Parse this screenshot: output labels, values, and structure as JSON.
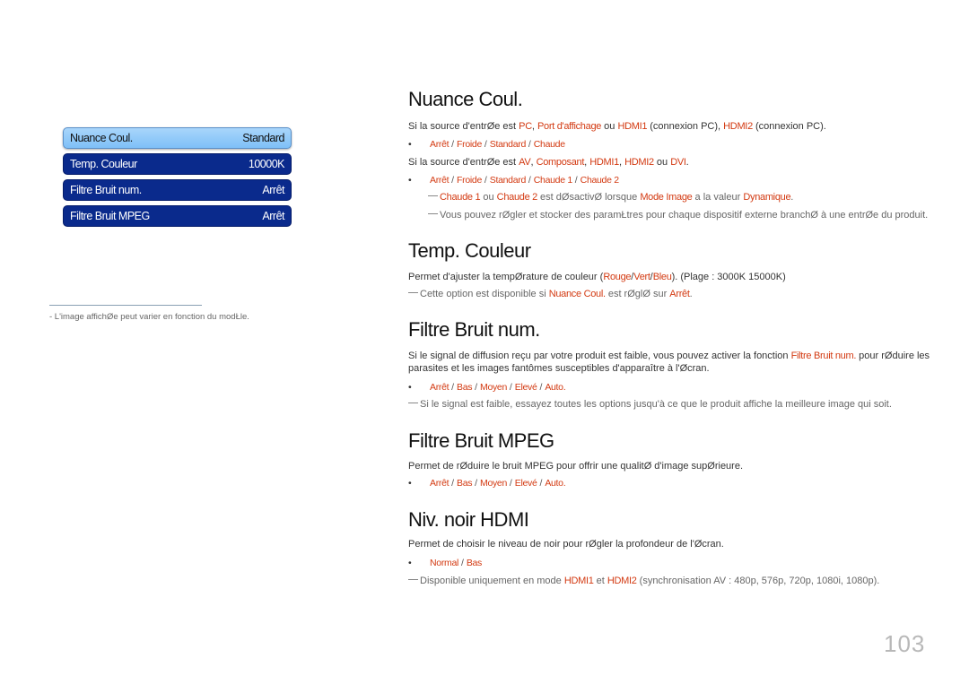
{
  "menu": {
    "rows": [
      {
        "label": "Nuance Coul.",
        "value": "Standard",
        "selected": true
      },
      {
        "label": "Temp. Couleur",
        "value": "10000K"
      },
      {
        "label": "Filtre Bruit num.",
        "value": "Arrêt"
      },
      {
        "label": "Filtre Bruit MPEG",
        "value": "Arrêt"
      }
    ]
  },
  "footnote": "-   L'image affichØe peut varier en fonction du modŁle.",
  "sections": {
    "nuance": {
      "title": "Nuance Coul.",
      "p1_pre": "Si la source d'entrØe est ",
      "p1_h1": "PC",
      "p1_sep1": ", ",
      "p1_h2": "Port d'affichage",
      "p1_mid": " ou ",
      "p1_h3": "HDMI1",
      "p1_mid2": " (connexion PC), ",
      "p1_h4": "HDMI2",
      "p1_post": " (connexion PC).",
      "opts1": [
        "Arrêt",
        "Froide",
        "Standard",
        "Chaude"
      ],
      "p2_pre": "Si la source d'entrØe est ",
      "p2_h1": "AV",
      "p2_sep1": ", ",
      "p2_h2": "Composant",
      "p2_sep2": ", ",
      "p2_h3": "HDMI1",
      "p2_sep3": ", ",
      "p2_h4": "HDMI2",
      "p2_mid": " ou ",
      "p2_h5": "DVI",
      "p2_post": ".",
      "opts2": [
        "Arrêt",
        "Froide",
        "Standard",
        "Chaude 1",
        "Chaude 2"
      ],
      "note1_h1": "Chaude 1",
      "note1_mid": " ou ",
      "note1_h2": "Chaude 2",
      "note1_mid2": " est dØsactivØ lorsque ",
      "note1_h3": "Mode Image",
      "note1_mid3": " a la valeur ",
      "note1_h4": "Dynamique",
      "note1_post": ".",
      "note2": "Vous pouvez rØgler et stocker des paramŁtres pour chaque dispositif externe branchØ à une entrØe du produit."
    },
    "temp": {
      "title": "Temp. Couleur",
      "p_pre": "Permet d'ajuster la tempØrature de couleur (",
      "p_h1": "Rouge",
      "p_s1": "/",
      "p_h2": "Vert",
      "p_s2": "/",
      "p_h3": "Bleu",
      "p_post": "). (Plage : 3000K 15000K)",
      "note_pre": "Cette option est disponible si ",
      "note_h1": "Nuance Coul.",
      "note_mid": " est rØglØ sur ",
      "note_h2": "Arrêt",
      "note_post": "."
    },
    "bruit": {
      "title": "Filtre Bruit num.",
      "p1_pre": "Si le signal de diffusion reçu par votre produit est faible, vous pouvez activer la fonction ",
      "p1_h1": "Filtre Bruit num.",
      "p1_post": " pour rØduire les",
      "p2": "parasites et les images fantômes susceptibles d'apparaître à l'Øcran.",
      "opts": [
        "Arrêt",
        "Bas",
        "Moyen",
        "Elevé",
        "Auto."
      ],
      "note": "Si le signal est faible, essayez toutes les options jusqu'à ce que le produit affiche la meilleure image qui soit."
    },
    "mpeg": {
      "title": "Filtre Bruit MPEG",
      "p": "Permet de rØduire le bruit MPEG pour offrir une qualitØ d'image supØrieure.",
      "opts": [
        "Arrêt",
        "Bas",
        "Moyen",
        "Elevé",
        "Auto."
      ]
    },
    "hdmi": {
      "title": "Niv. noir HDMI",
      "p": "Permet de choisir le niveau de noir pour rØgler la profondeur de l'Øcran.",
      "opts": [
        "Normal",
        "Bas"
      ],
      "note_pre": "Disponible uniquement en mode ",
      "note_h1": "HDMI1",
      "note_mid": " et ",
      "note_h2": "HDMI2",
      "note_post": " (synchronisation AV : 480p, 576p, 720p, 1080i, 1080p)."
    }
  },
  "page_number": "103",
  "colors": {
    "accent": "#d33a12",
    "menu_bg": "#0a2a8c",
    "menu_selected": "#8cc8f9"
  }
}
